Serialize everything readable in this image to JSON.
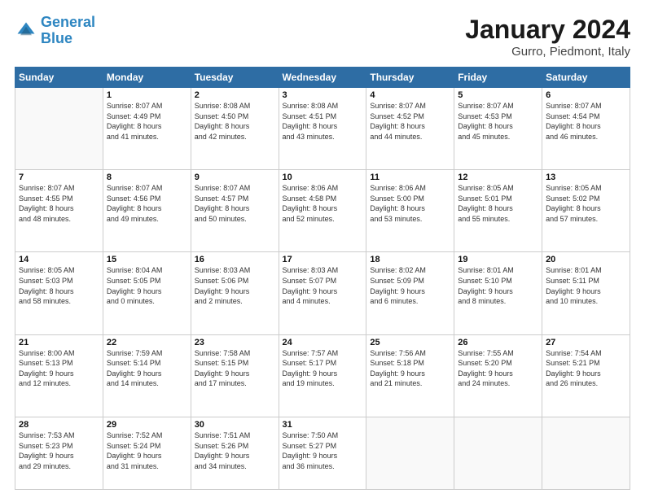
{
  "header": {
    "logo_line1": "General",
    "logo_line2": "Blue",
    "month": "January 2024",
    "location": "Gurro, Piedmont, Italy"
  },
  "weekdays": [
    "Sunday",
    "Monday",
    "Tuesday",
    "Wednesday",
    "Thursday",
    "Friday",
    "Saturday"
  ],
  "weeks": [
    [
      {
        "num": "",
        "info": ""
      },
      {
        "num": "1",
        "info": "Sunrise: 8:07 AM\nSunset: 4:49 PM\nDaylight: 8 hours\nand 41 minutes."
      },
      {
        "num": "2",
        "info": "Sunrise: 8:08 AM\nSunset: 4:50 PM\nDaylight: 8 hours\nand 42 minutes."
      },
      {
        "num": "3",
        "info": "Sunrise: 8:08 AM\nSunset: 4:51 PM\nDaylight: 8 hours\nand 43 minutes."
      },
      {
        "num": "4",
        "info": "Sunrise: 8:07 AM\nSunset: 4:52 PM\nDaylight: 8 hours\nand 44 minutes."
      },
      {
        "num": "5",
        "info": "Sunrise: 8:07 AM\nSunset: 4:53 PM\nDaylight: 8 hours\nand 45 minutes."
      },
      {
        "num": "6",
        "info": "Sunrise: 8:07 AM\nSunset: 4:54 PM\nDaylight: 8 hours\nand 46 minutes."
      }
    ],
    [
      {
        "num": "7",
        "info": "Sunrise: 8:07 AM\nSunset: 4:55 PM\nDaylight: 8 hours\nand 48 minutes."
      },
      {
        "num": "8",
        "info": "Sunrise: 8:07 AM\nSunset: 4:56 PM\nDaylight: 8 hours\nand 49 minutes."
      },
      {
        "num": "9",
        "info": "Sunrise: 8:07 AM\nSunset: 4:57 PM\nDaylight: 8 hours\nand 50 minutes."
      },
      {
        "num": "10",
        "info": "Sunrise: 8:06 AM\nSunset: 4:58 PM\nDaylight: 8 hours\nand 52 minutes."
      },
      {
        "num": "11",
        "info": "Sunrise: 8:06 AM\nSunset: 5:00 PM\nDaylight: 8 hours\nand 53 minutes."
      },
      {
        "num": "12",
        "info": "Sunrise: 8:05 AM\nSunset: 5:01 PM\nDaylight: 8 hours\nand 55 minutes."
      },
      {
        "num": "13",
        "info": "Sunrise: 8:05 AM\nSunset: 5:02 PM\nDaylight: 8 hours\nand 57 minutes."
      }
    ],
    [
      {
        "num": "14",
        "info": "Sunrise: 8:05 AM\nSunset: 5:03 PM\nDaylight: 8 hours\nand 58 minutes."
      },
      {
        "num": "15",
        "info": "Sunrise: 8:04 AM\nSunset: 5:05 PM\nDaylight: 9 hours\nand 0 minutes."
      },
      {
        "num": "16",
        "info": "Sunrise: 8:03 AM\nSunset: 5:06 PM\nDaylight: 9 hours\nand 2 minutes."
      },
      {
        "num": "17",
        "info": "Sunrise: 8:03 AM\nSunset: 5:07 PM\nDaylight: 9 hours\nand 4 minutes."
      },
      {
        "num": "18",
        "info": "Sunrise: 8:02 AM\nSunset: 5:09 PM\nDaylight: 9 hours\nand 6 minutes."
      },
      {
        "num": "19",
        "info": "Sunrise: 8:01 AM\nSunset: 5:10 PM\nDaylight: 9 hours\nand 8 minutes."
      },
      {
        "num": "20",
        "info": "Sunrise: 8:01 AM\nSunset: 5:11 PM\nDaylight: 9 hours\nand 10 minutes."
      }
    ],
    [
      {
        "num": "21",
        "info": "Sunrise: 8:00 AM\nSunset: 5:13 PM\nDaylight: 9 hours\nand 12 minutes."
      },
      {
        "num": "22",
        "info": "Sunrise: 7:59 AM\nSunset: 5:14 PM\nDaylight: 9 hours\nand 14 minutes."
      },
      {
        "num": "23",
        "info": "Sunrise: 7:58 AM\nSunset: 5:15 PM\nDaylight: 9 hours\nand 17 minutes."
      },
      {
        "num": "24",
        "info": "Sunrise: 7:57 AM\nSunset: 5:17 PM\nDaylight: 9 hours\nand 19 minutes."
      },
      {
        "num": "25",
        "info": "Sunrise: 7:56 AM\nSunset: 5:18 PM\nDaylight: 9 hours\nand 21 minutes."
      },
      {
        "num": "26",
        "info": "Sunrise: 7:55 AM\nSunset: 5:20 PM\nDaylight: 9 hours\nand 24 minutes."
      },
      {
        "num": "27",
        "info": "Sunrise: 7:54 AM\nSunset: 5:21 PM\nDaylight: 9 hours\nand 26 minutes."
      }
    ],
    [
      {
        "num": "28",
        "info": "Sunrise: 7:53 AM\nSunset: 5:23 PM\nDaylight: 9 hours\nand 29 minutes."
      },
      {
        "num": "29",
        "info": "Sunrise: 7:52 AM\nSunset: 5:24 PM\nDaylight: 9 hours\nand 31 minutes."
      },
      {
        "num": "30",
        "info": "Sunrise: 7:51 AM\nSunset: 5:26 PM\nDaylight: 9 hours\nand 34 minutes."
      },
      {
        "num": "31",
        "info": "Sunrise: 7:50 AM\nSunset: 5:27 PM\nDaylight: 9 hours\nand 36 minutes."
      },
      {
        "num": "",
        "info": ""
      },
      {
        "num": "",
        "info": ""
      },
      {
        "num": "",
        "info": ""
      }
    ]
  ]
}
